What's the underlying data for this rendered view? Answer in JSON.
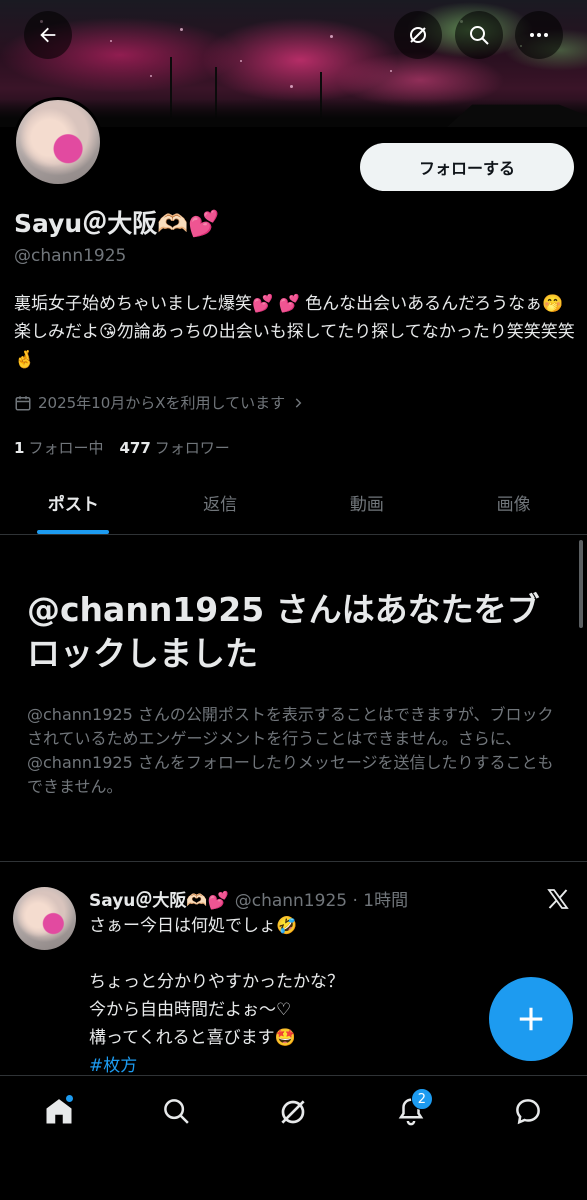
{
  "profile": {
    "name": "Sayu＠大阪🫶🏻💕",
    "handle": "@chann1925",
    "follow_label": "フォローする",
    "bio": "裏垢女子始めちゃいました爆笑💕 💕 色んな出会いあるんだろうなぁ🤭楽しみだよ😘勿論あっちの出会いも探してたり探してなかったり笑笑笑笑🤞",
    "joined": "2025年10月からXを利用しています",
    "following_count": "1",
    "following_label": "フォロー中",
    "followers_count": "477",
    "followers_label": "フォロワー"
  },
  "tabs": [
    {
      "label": "ポスト",
      "active": true
    },
    {
      "label": "返信",
      "active": false
    },
    {
      "label": "動画",
      "active": false
    },
    {
      "label": "画像",
      "active": false
    }
  ],
  "blocked": {
    "title": "@chann1925 さんはあなたをブロックしました",
    "description": "@chann1925 さんの公開ポストを表示することはできますが、ブロックされているためエンゲージメントを行うことはできません。さらに、@chann1925 さんをフォローしたりメッセージを送信したりすることもできません。"
  },
  "post": {
    "author": "Sayu＠大阪🫶🏻💕",
    "meta": "@chann1925 · 1時間",
    "lines": [
      "さぁー今日は何処でしょ🤣",
      "",
      "ちょっと分かりやすかったかな？",
      "今から自由時間だよぉ〜♡",
      "構ってくれると喜びます🤩"
    ],
    "hashtag": "#枚方"
  },
  "nav": {
    "notifications_badge": "2"
  },
  "icons": {
    "back": "back-arrow-icon",
    "grok": "grok-icon",
    "search": "search-icon",
    "more": "more-icon",
    "calendar": "calendar-icon",
    "x_logo": "x-logo-icon",
    "compose": "plus-icon",
    "home": "home-icon",
    "explore": "search-icon",
    "grok_nav": "grok-icon",
    "notifications": "bell-icon",
    "messages": "chat-icon"
  },
  "colors": {
    "accent": "#1d9bf0",
    "background": "#000000",
    "text": "#e7e9ea",
    "muted": "#71767b"
  }
}
